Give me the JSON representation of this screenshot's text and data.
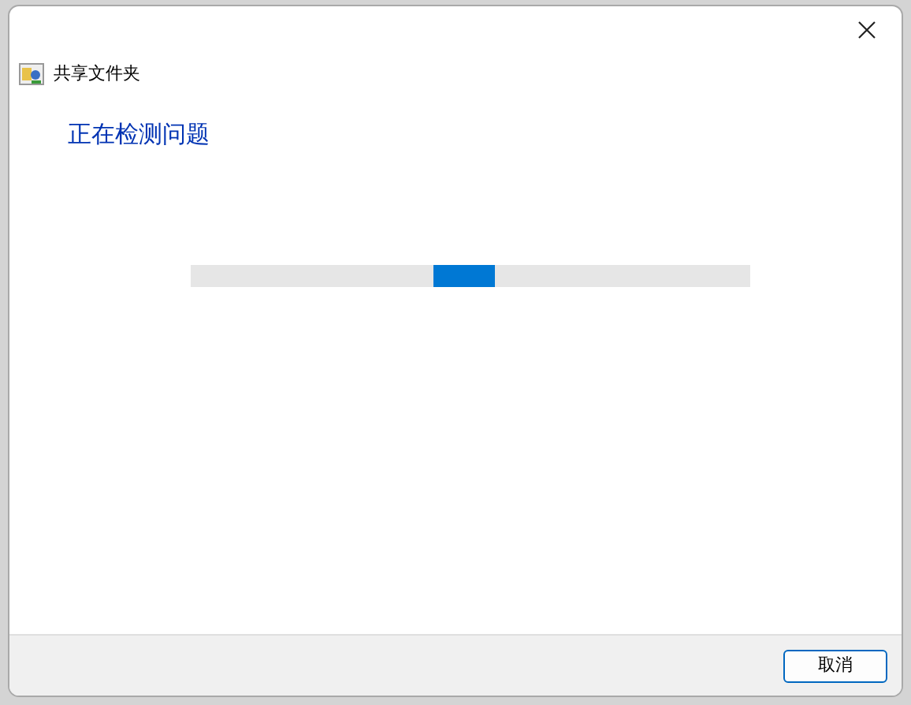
{
  "window": {
    "title": "共享文件夹"
  },
  "heading": "正在检测问题",
  "progress": {
    "kind": "marquee"
  },
  "buttons": [
    "取消"
  ]
}
